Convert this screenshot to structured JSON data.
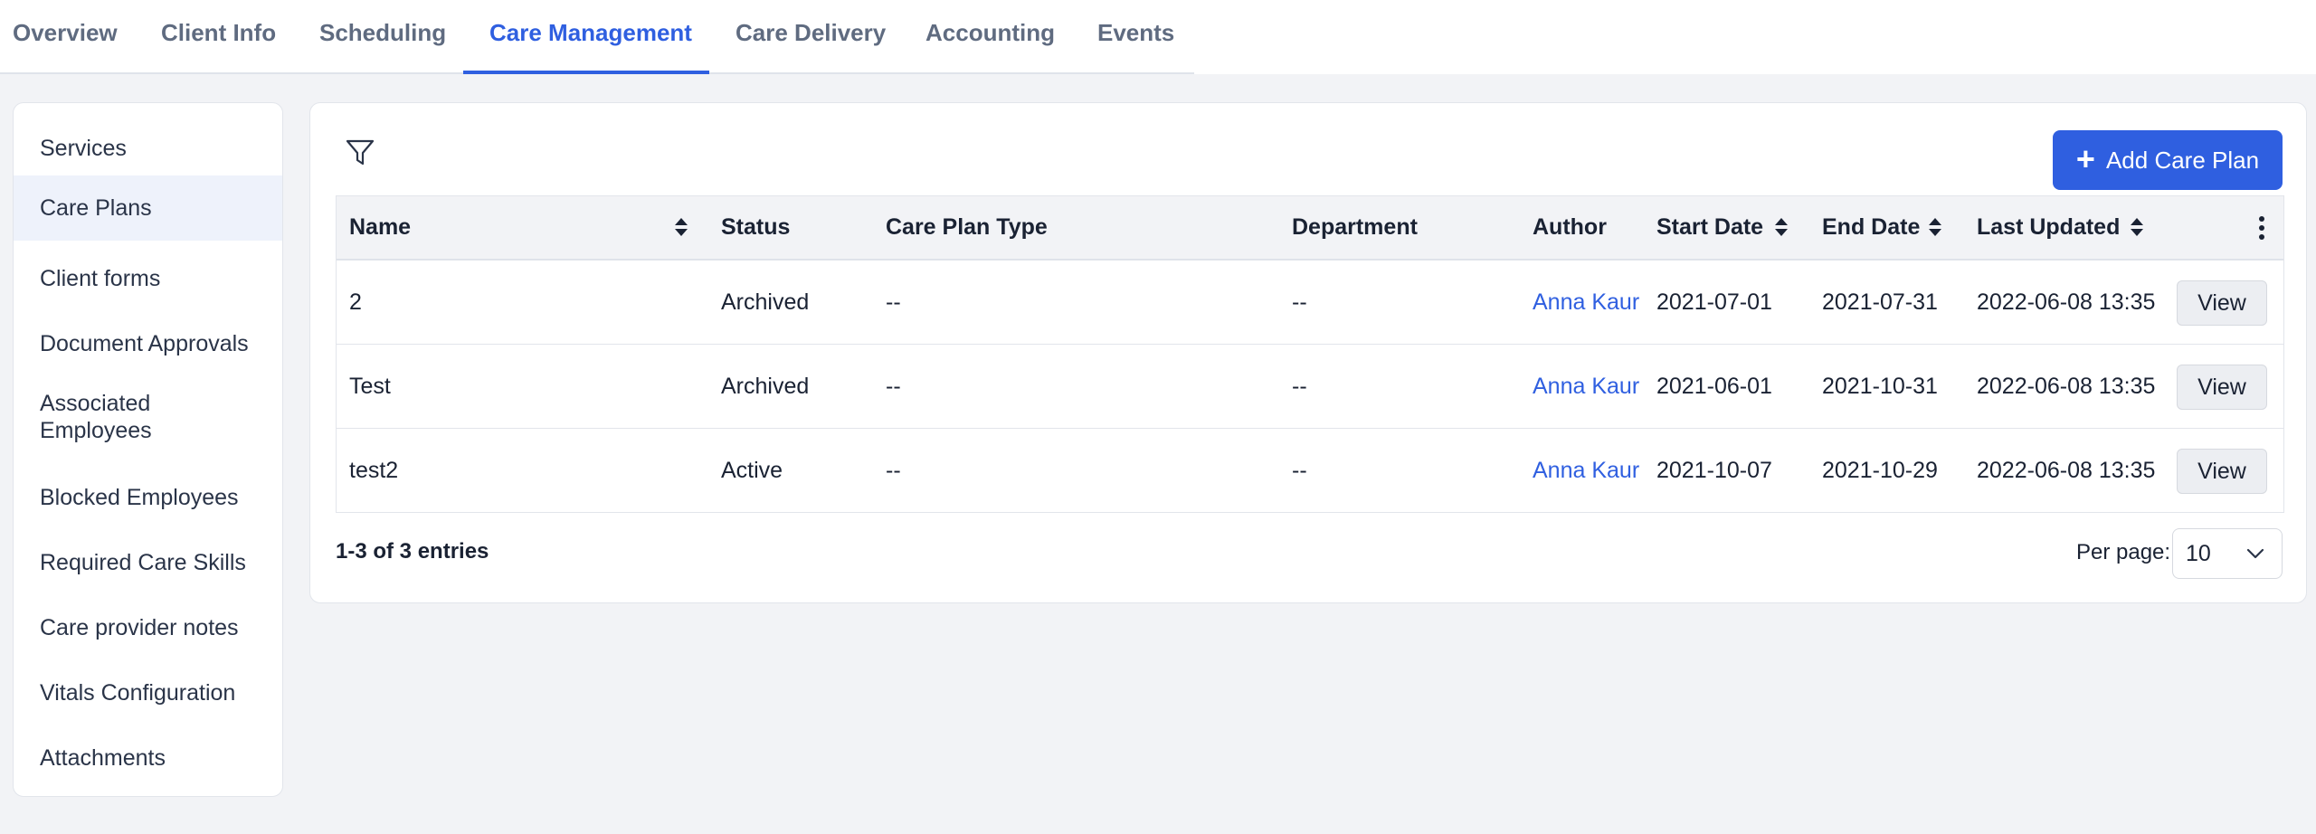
{
  "tabs": [
    {
      "label": "Overview"
    },
    {
      "label": "Client Info"
    },
    {
      "label": "Scheduling"
    },
    {
      "label": "Care Management",
      "active": true
    },
    {
      "label": "Care Delivery"
    },
    {
      "label": "Accounting"
    },
    {
      "label": "Events"
    }
  ],
  "sidebar": {
    "items": [
      {
        "label": "Services"
      },
      {
        "label": "Care Plans",
        "active": true
      },
      {
        "label": "Client forms"
      },
      {
        "label": "Document Approvals"
      },
      {
        "label": "Associated Employees"
      },
      {
        "label": "Blocked Employees"
      },
      {
        "label": "Required Care Skills"
      },
      {
        "label": "Care provider notes"
      },
      {
        "label": "Vitals Configuration"
      },
      {
        "label": "Attachments"
      }
    ]
  },
  "toolbar": {
    "filter_icon": "filter-icon",
    "add_label": "Add Care Plan"
  },
  "table": {
    "columns": [
      "Name",
      "Status",
      "Care Plan Type",
      "Department",
      "Author",
      "Start Date",
      "End Date",
      "Last Updated"
    ],
    "rows": [
      {
        "name": "2",
        "status": "Archived",
        "type": "--",
        "department": "--",
        "author": "Anna Kaur",
        "start": "2021-07-01",
        "end": "2021-07-31",
        "updated": "2022-06-08 13:35",
        "action": "View"
      },
      {
        "name": "Test",
        "status": "Archived",
        "type": "--",
        "department": "--",
        "author": "Anna Kaur",
        "start": "2021-06-01",
        "end": "2021-10-31",
        "updated": "2022-06-08 13:35",
        "action": "View"
      },
      {
        "name": "test2",
        "status": "Active",
        "type": "--",
        "department": "--",
        "author": "Anna Kaur",
        "start": "2021-10-07",
        "end": "2021-10-29",
        "updated": "2022-06-08 13:35",
        "action": "View"
      }
    ]
  },
  "footer": {
    "entries": "1-3 of 3 entries",
    "per_page_label": "Per page:",
    "per_page_value": "10"
  },
  "colors": {
    "accent": "#2f5fe0",
    "background": "#f2f3f6"
  }
}
